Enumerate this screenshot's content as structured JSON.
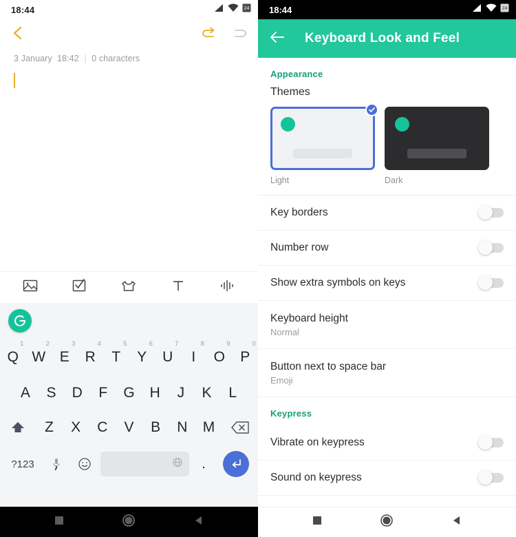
{
  "left_screen": {
    "status_bar": {
      "time": "18:44",
      "icons": [
        "signal-icon",
        "wifi-icon",
        "battery-icon"
      ]
    },
    "toolbar": {
      "back_label": "back-chevron",
      "undo_label": "undo",
      "redo_label": "redo",
      "back_color": "#e8b023",
      "undo_color": "#e8b023",
      "redo_color": "#c9c9c9"
    },
    "note": {
      "date": "3 January",
      "time": "18:42",
      "separator": "|",
      "char_count": "0 characters",
      "body_text": "",
      "caret_color": "#e8b023"
    },
    "attachment_bar": {
      "items": [
        {
          "name": "image-icon",
          "label": "Image"
        },
        {
          "name": "checklist-icon",
          "label": "Checklist"
        },
        {
          "name": "sticker-icon",
          "label": "Sticker"
        },
        {
          "name": "text-icon",
          "label": "Text"
        },
        {
          "name": "audio-icon",
          "label": "Audio"
        }
      ]
    },
    "keyboard": {
      "suggestion_logo": "grammarly-icon",
      "logo_color": "#15c39a",
      "row1": [
        {
          "key": "Q",
          "num": "1"
        },
        {
          "key": "W",
          "num": "2"
        },
        {
          "key": "E",
          "num": "3"
        },
        {
          "key": "R",
          "num": "4"
        },
        {
          "key": "T",
          "num": "5"
        },
        {
          "key": "Y",
          "num": "6"
        },
        {
          "key": "U",
          "num": "7"
        },
        {
          "key": "I",
          "num": "8"
        },
        {
          "key": "O",
          "num": "9"
        },
        {
          "key": "P",
          "num": "0"
        }
      ],
      "row2": [
        "A",
        "S",
        "D",
        "F",
        "G",
        "H",
        "J",
        "K",
        "L"
      ],
      "row3": [
        "Z",
        "X",
        "C",
        "V",
        "B",
        "N",
        "M"
      ],
      "shift_icon": "shift-icon",
      "backspace_icon": "backspace-icon",
      "symbols_key": "?123",
      "mic_key": ",",
      "emoji_key": "emoji-icon",
      "space_key": "",
      "globe_icon": "globe-icon",
      "period_key": ".",
      "enter_icon": "enter-icon",
      "enter_color": "#4a6fd6"
    },
    "nav_bar": {
      "recents": "square-icon",
      "home": "circle-icon",
      "back": "triangle-back-icon"
    }
  },
  "right_screen": {
    "status_bar": {
      "time": "18:44",
      "icons": [
        "signal-icon",
        "wifi-icon",
        "battery-icon"
      ]
    },
    "app_bar": {
      "back_icon": "arrow-back-icon",
      "title": "Keyboard Look and Feel",
      "color": "#22c79b"
    },
    "sections": {
      "appearance": {
        "header": "Appearance",
        "themes_label": "Themes",
        "themes": [
          {
            "name": "Light",
            "selected": true
          },
          {
            "name": "Dark",
            "selected": false
          }
        ],
        "rows": [
          {
            "title": "Key borders",
            "value": "off"
          },
          {
            "title": "Number row",
            "value": "off"
          },
          {
            "title": "Show extra symbols on keys",
            "value": "off"
          }
        ],
        "detail_rows": [
          {
            "title": "Keyboard height",
            "sub": "Normal"
          },
          {
            "title": "Button next to space bar",
            "sub": "Emoji"
          }
        ]
      },
      "keypress": {
        "header": "Keypress",
        "rows": [
          {
            "title": "Vibrate on keypress",
            "value": "off"
          },
          {
            "title": "Sound on keypress",
            "value": "off"
          }
        ]
      }
    },
    "nav_bar": {
      "recents": "square-icon",
      "home": "circle-icon",
      "back": "triangle-back-icon"
    }
  }
}
